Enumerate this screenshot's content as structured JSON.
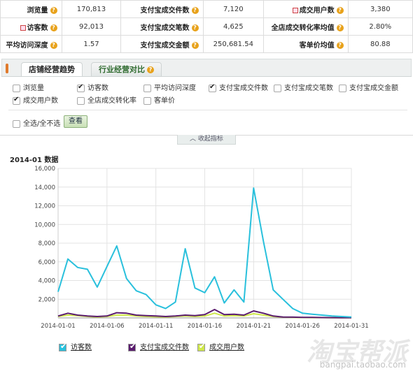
{
  "stats": [
    [
      {
        "label": "浏览量",
        "value": "170,813",
        "flag": false
      },
      {
        "label": "支付宝成交件数",
        "value": "7,120",
        "flag": false
      },
      {
        "label": "成交用户数",
        "value": "3,380",
        "flag": true
      }
    ],
    [
      {
        "label": "访客数",
        "value": "92,013",
        "flag": true
      },
      {
        "label": "支付宝成交笔数",
        "value": "4,625",
        "flag": false
      },
      {
        "label": "全店成交转化率均值",
        "value": "2.80%",
        "flag": false
      }
    ],
    [
      {
        "label": "平均访问深度",
        "value": "1.57",
        "flag": false
      },
      {
        "label": "支付宝成交金额",
        "value": "250,681.54",
        "flag": false
      },
      {
        "label": "客单价均值",
        "value": "80.88",
        "flag": false
      }
    ]
  ],
  "tabs": {
    "active": "店铺经营趋势",
    "inactive": "行业经营对比"
  },
  "options": [
    {
      "label": "浏览量",
      "checked": false
    },
    {
      "label": "访客数",
      "checked": true
    },
    {
      "label": "平均访问深度",
      "checked": false
    },
    {
      "label": "支付宝成交件数",
      "checked": true
    },
    {
      "label": "支付宝成交笔数",
      "checked": false
    },
    {
      "label": "支付宝成交金额",
      "checked": false
    },
    {
      "label": "成交用户数",
      "checked": true
    },
    {
      "label": "全店成交转化率",
      "checked": false
    },
    {
      "label": "客单价",
      "checked": false
    }
  ],
  "select_all": {
    "label": "全选/全不选",
    "checked": false
  },
  "view_button": "查看",
  "collapse_label": "收起指标",
  "chart_title": "2014-01 数据",
  "colors": {
    "visitors": "#29c0dc",
    "items": "#5a1b6e",
    "buyers": "#cfe84a",
    "accent": "#e8a21b"
  },
  "chart_data": {
    "type": "line",
    "x": [
      "2014-01-01",
      "2014-01-02",
      "2014-01-03",
      "2014-01-04",
      "2014-01-05",
      "2014-01-06",
      "2014-01-07",
      "2014-01-08",
      "2014-01-09",
      "2014-01-10",
      "2014-01-11",
      "2014-01-12",
      "2014-01-13",
      "2014-01-14",
      "2014-01-15",
      "2014-01-16",
      "2014-01-17",
      "2014-01-18",
      "2014-01-19",
      "2014-01-20",
      "2014-01-21",
      "2014-01-22",
      "2014-01-23",
      "2014-01-24",
      "2014-01-25",
      "2014-01-26",
      "2014-01-27",
      "2014-01-28",
      "2014-01-29",
      "2014-01-30",
      "2014-01-31"
    ],
    "xticks": [
      "2014-01-01",
      "2014-01-06",
      "2014-01-11",
      "2014-01-16",
      "2014-01-21",
      "2014-01-26",
      "2014-01-31"
    ],
    "yticks": [
      "16,000",
      "14,000",
      "12,000",
      "10,000",
      "8,000",
      "6,000",
      "4,000",
      "2,000"
    ],
    "ylim": [
      0,
      16000
    ],
    "series": [
      {
        "name": "访客数",
        "values": [
          2800,
          6300,
          5400,
          5200,
          3300,
          5500,
          7700,
          4200,
          2900,
          2500,
          1400,
          1000,
          1700,
          7400,
          3200,
          2700,
          4400,
          1600,
          3000,
          1700,
          13900,
          8200,
          3000,
          2000,
          1000,
          500,
          400,
          300,
          200,
          150,
          100
        ]
      },
      {
        "name": "支付宝成交件数",
        "values": [
          200,
          500,
          300,
          200,
          150,
          200,
          550,
          500,
          300,
          250,
          200,
          150,
          200,
          300,
          250,
          350,
          900,
          350,
          400,
          300,
          750,
          500,
          200,
          100,
          80,
          60,
          50,
          40,
          30,
          20,
          20
        ]
      },
      {
        "name": "成交用户数",
        "values": [
          150,
          300,
          250,
          150,
          100,
          150,
          300,
          300,
          200,
          150,
          120,
          100,
          150,
          200,
          150,
          200,
          500,
          200,
          250,
          200,
          450,
          300,
          150,
          80,
          60,
          40,
          30,
          30,
          20,
          15,
          15
        ]
      }
    ]
  },
  "watermark": "淘宝帮派",
  "watermark_url": "bangpai.taobao.com"
}
